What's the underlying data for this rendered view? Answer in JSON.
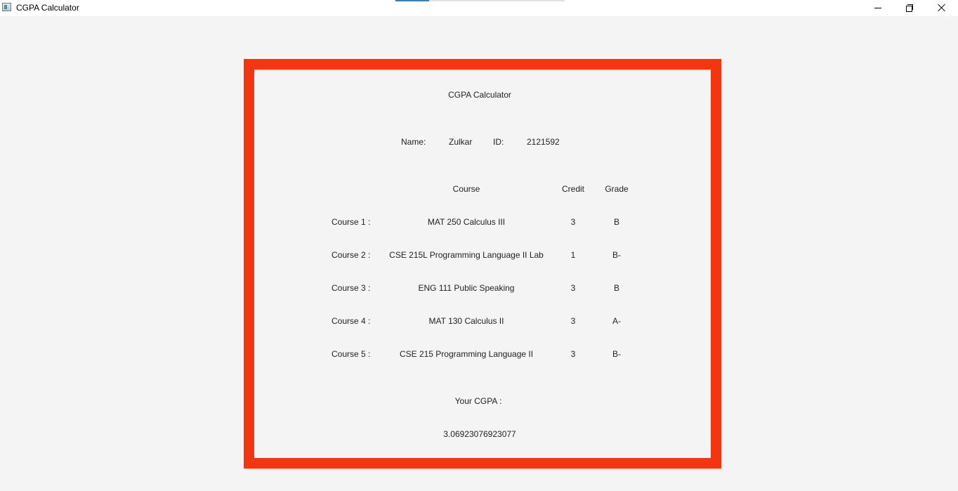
{
  "window": {
    "title": "CGPA Calculator",
    "icon": "app-window-icon",
    "controls": {
      "minimize_icon": "minimize-icon",
      "restore_icon": "restore-icon",
      "close_icon": "close-icon"
    }
  },
  "panel": {
    "border_color": "#f43512",
    "heading": "CGPA Calculator",
    "name_label": "Name:",
    "name_value": "Zulkar",
    "id_label": "ID:",
    "id_value": "2121592",
    "headers": {
      "course": "Course",
      "credit": "Credit",
      "grade": "Grade"
    },
    "courses": [
      {
        "label": "Course 1 :",
        "course": "MAT 250 Calculus III",
        "credit": "3",
        "grade": "B"
      },
      {
        "label": "Course 2 :",
        "course": "CSE 215L Programming Language II Lab",
        "credit": "1",
        "grade": "B-"
      },
      {
        "label": "Course 3 :",
        "course": "ENG 111 Public Speaking",
        "credit": "3",
        "grade": "B"
      },
      {
        "label": "Course 4 :",
        "course": "MAT 130 Calculus II",
        "credit": "3",
        "grade": "A-"
      },
      {
        "label": "Course 5 :",
        "course": "CSE 215 Programming Language II",
        "credit": "3",
        "grade": "B-"
      }
    ],
    "cgpa_label": "Your CGPA :",
    "cgpa_value": "3.06923076923077"
  }
}
